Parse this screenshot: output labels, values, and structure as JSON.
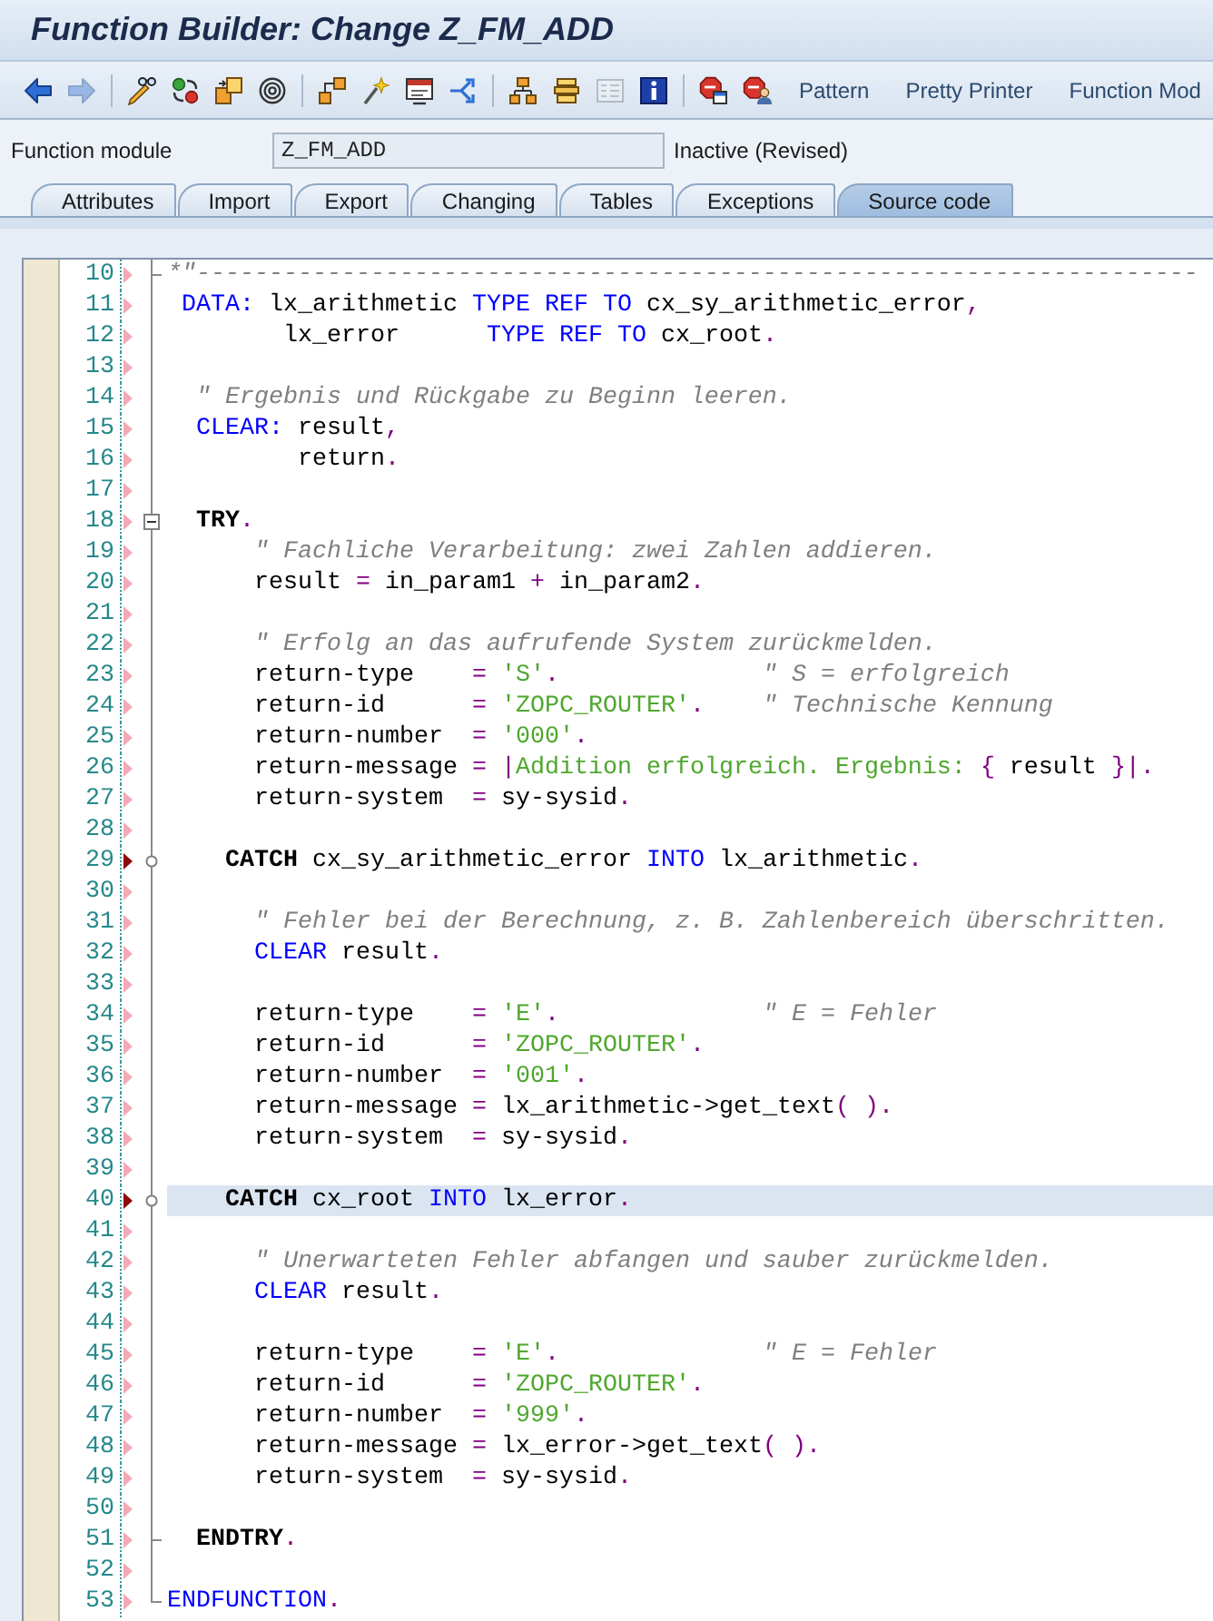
{
  "title": "Function Builder: Change Z_FM_ADD",
  "toolbar": {
    "groups": [
      [
        {
          "kind": "left",
          "disabled": false
        },
        {
          "kind": "right",
          "disabled": true
        }
      ],
      [
        {
          "kind": "pencil",
          "disabled": false
        },
        {
          "kind": "dots",
          "disabled": false
        },
        {
          "kind": "squares",
          "disabled": false
        },
        {
          "kind": "spiral",
          "disabled": false
        }
      ],
      [
        {
          "kind": "boxes",
          "disabled": false
        },
        {
          "kind": "wand",
          "disabled": false
        },
        {
          "kind": "screen",
          "disabled": false
        },
        {
          "kind": "branch",
          "disabled": false
        }
      ],
      [
        {
          "kind": "tree",
          "disabled": false
        },
        {
          "kind": "stack",
          "disabled": false
        },
        {
          "kind": "list",
          "disabled": true
        },
        {
          "kind": "info",
          "disabled": false
        }
      ],
      [
        {
          "kind": "stop",
          "disabled": false
        },
        {
          "kind": "stopuser",
          "disabled": false
        }
      ]
    ],
    "buttons": [
      "Pattern",
      "Pretty Printer",
      "Function Mod"
    ]
  },
  "module_field": {
    "label": "Function module",
    "value": "Z_FM_ADD",
    "status": "Inactive (Revised)"
  },
  "tabs": [
    {
      "label": "Attributes",
      "selected": false
    },
    {
      "label": "Import",
      "selected": false
    },
    {
      "label": "Export",
      "selected": false
    },
    {
      "label": "Changing",
      "selected": false
    },
    {
      "label": "Tables",
      "selected": false
    },
    {
      "label": "Exceptions",
      "selected": false
    },
    {
      "label": "Source code",
      "selected": true
    }
  ],
  "editor": {
    "lines": [
      {
        "number": "10",
        "kind": "tick",
        "flagged": false,
        "highlighted": false,
        "tokens": [
          {
            "text": "*\"---------------------------------------------------------------------",
            "kind": "comment"
          }
        ]
      },
      {
        "number": "11",
        "kind": "plain",
        "flagged": false,
        "highlighted": false,
        "tokens": [
          {
            "text": " DATA:",
            "kind": "keyword"
          },
          {
            "text": " lx_arithmetic ",
            "kind": "text"
          },
          {
            "text": "TYPE REF TO",
            "kind": "keyword"
          },
          {
            "text": " cx_sy_arithmetic_error",
            "kind": "text"
          },
          {
            "text": ",",
            "kind": "operator"
          }
        ]
      },
      {
        "number": "12",
        "kind": "plain",
        "flagged": false,
        "highlighted": false,
        "tokens": [
          {
            "text": "        lx_error      ",
            "kind": "text"
          },
          {
            "text": "TYPE REF TO",
            "kind": "keyword"
          },
          {
            "text": " cx_root",
            "kind": "text"
          },
          {
            "text": ".",
            "kind": "operator"
          }
        ]
      },
      {
        "number": "13",
        "kind": "plain",
        "flagged": false,
        "highlighted": false
      },
      {
        "number": "14",
        "kind": "plain",
        "flagged": false,
        "highlighted": false,
        "tokens": [
          {
            "text": "  \" Ergebnis und Rückgabe zu Beginn leeren.",
            "kind": "comment"
          }
        ]
      },
      {
        "number": "15",
        "kind": "plain",
        "flagged": false,
        "highlighted": false,
        "tokens": [
          {
            "text": "  CLEAR:",
            "kind": "keyword"
          },
          {
            "text": " result",
            "kind": "text"
          },
          {
            "text": ",",
            "kind": "operator"
          }
        ]
      },
      {
        "number": "16",
        "kind": "plain",
        "flagged": false,
        "highlighted": false,
        "tokens": [
          {
            "text": "         return",
            "kind": "text"
          },
          {
            "text": ".",
            "kind": "operator"
          }
        ]
      },
      {
        "number": "17",
        "kind": "plain",
        "flagged": false,
        "highlighted": false
      },
      {
        "number": "18",
        "kind": "start",
        "flagged": false,
        "highlighted": false,
        "tokens": [
          {
            "text": "  TRY",
            "kind": "control"
          },
          {
            "text": ".",
            "kind": "operator"
          }
        ]
      },
      {
        "number": "19",
        "kind": "plain",
        "flagged": false,
        "highlighted": false,
        "tokens": [
          {
            "text": "      \" Fachliche Verarbeitung: zwei Zahlen addieren.",
            "kind": "comment"
          }
        ]
      },
      {
        "number": "20",
        "kind": "plain",
        "flagged": false,
        "highlighted": false,
        "tokens": [
          {
            "text": "      result ",
            "kind": "text"
          },
          {
            "text": "=",
            "kind": "operator"
          },
          {
            "text": " in_param1 ",
            "kind": "text"
          },
          {
            "text": "+",
            "kind": "operator"
          },
          {
            "text": " in_param2",
            "kind": "text"
          },
          {
            "text": ".",
            "kind": "operator"
          }
        ]
      },
      {
        "number": "21",
        "kind": "plain",
        "flagged": false,
        "highlighted": false
      },
      {
        "number": "22",
        "kind": "plain",
        "flagged": false,
        "highlighted": false,
        "tokens": [
          {
            "text": "      \" Erfolg an das aufrufende System zurückmelden.",
            "kind": "comment"
          }
        ]
      },
      {
        "number": "23",
        "kind": "plain",
        "flagged": false,
        "highlighted": false,
        "tokens": [
          {
            "text": "      return-type    ",
            "kind": "text"
          },
          {
            "text": "= ",
            "kind": "operator"
          },
          {
            "text": "'S'",
            "kind": "string"
          },
          {
            "text": ".",
            "kind": "operator"
          },
          {
            "text": "              \" S = erfolgreich",
            "kind": "comment"
          }
        ]
      },
      {
        "number": "24",
        "kind": "plain",
        "flagged": false,
        "highlighted": false,
        "tokens": [
          {
            "text": "      return-id      ",
            "kind": "text"
          },
          {
            "text": "= ",
            "kind": "operator"
          },
          {
            "text": "'ZOPC_ROUTER'",
            "kind": "string"
          },
          {
            "text": ".",
            "kind": "operator"
          },
          {
            "text": "    \" Technische Kennung",
            "kind": "comment"
          }
        ]
      },
      {
        "number": "25",
        "kind": "plain",
        "flagged": false,
        "highlighted": false,
        "tokens": [
          {
            "text": "      return-number  ",
            "kind": "text"
          },
          {
            "text": "= ",
            "kind": "operator"
          },
          {
            "text": "'000'",
            "kind": "string"
          },
          {
            "text": ".",
            "kind": "operator"
          }
        ]
      },
      {
        "number": "26",
        "kind": "plain",
        "flagged": false,
        "highlighted": false,
        "tokens": [
          {
            "text": "      return-message ",
            "kind": "text"
          },
          {
            "text": "= |",
            "kind": "operator"
          },
          {
            "text": "Addition erfolgreich. Ergebnis: ",
            "kind": "string"
          },
          {
            "text": "{",
            "kind": "operator"
          },
          {
            "text": " result ",
            "kind": "text"
          },
          {
            "text": "}|.",
            "kind": "operator"
          }
        ]
      },
      {
        "number": "27",
        "kind": "plain",
        "flagged": false,
        "highlighted": false,
        "tokens": [
          {
            "text": "      return-system  ",
            "kind": "text"
          },
          {
            "text": "=",
            "kind": "operator"
          },
          {
            "text": " sy-sysid",
            "kind": "text"
          },
          {
            "text": ".",
            "kind": "operator"
          }
        ]
      },
      {
        "number": "28",
        "kind": "plain",
        "flagged": false,
        "highlighted": false
      },
      {
        "number": "29",
        "kind": "branch",
        "flagged": true,
        "highlighted": false,
        "tokens": [
          {
            "text": "    CATCH",
            "kind": "control"
          },
          {
            "text": " cx_sy_arithmetic_error ",
            "kind": "text"
          },
          {
            "text": "INTO",
            "kind": "keyword"
          },
          {
            "text": " lx_arithmetic",
            "kind": "text"
          },
          {
            "text": ".",
            "kind": "operator"
          }
        ]
      },
      {
        "number": "30",
        "kind": "plain",
        "flagged": false,
        "highlighted": false
      },
      {
        "number": "31",
        "kind": "plain",
        "flagged": false,
        "highlighted": false,
        "tokens": [
          {
            "text": "      \" Fehler bei der Berechnung, z. B. Zahlenbereich überschritten.",
            "kind": "comment"
          }
        ]
      },
      {
        "number": "32",
        "kind": "plain",
        "flagged": false,
        "highlighted": false,
        "tokens": [
          {
            "text": "      CLEAR",
            "kind": "keyword"
          },
          {
            "text": " result",
            "kind": "text"
          },
          {
            "text": ".",
            "kind": "operator"
          }
        ]
      },
      {
        "number": "33",
        "kind": "plain",
        "flagged": false,
        "highlighted": false
      },
      {
        "number": "34",
        "kind": "plain",
        "flagged": false,
        "highlighted": false,
        "tokens": [
          {
            "text": "      return-type    ",
            "kind": "text"
          },
          {
            "text": "= ",
            "kind": "operator"
          },
          {
            "text": "'E'",
            "kind": "string"
          },
          {
            "text": ".",
            "kind": "operator"
          },
          {
            "text": "              \" E = Fehler",
            "kind": "comment"
          }
        ]
      },
      {
        "number": "35",
        "kind": "plain",
        "flagged": false,
        "highlighted": false,
        "tokens": [
          {
            "text": "      return-id      ",
            "kind": "text"
          },
          {
            "text": "= ",
            "kind": "operator"
          },
          {
            "text": "'ZOPC_ROUTER'",
            "kind": "string"
          },
          {
            "text": ".",
            "kind": "operator"
          }
        ]
      },
      {
        "number": "36",
        "kind": "plain",
        "flagged": false,
        "highlighted": false,
        "tokens": [
          {
            "text": "      return-number  ",
            "kind": "text"
          },
          {
            "text": "= ",
            "kind": "operator"
          },
          {
            "text": "'001'",
            "kind": "string"
          },
          {
            "text": ".",
            "kind": "operator"
          }
        ]
      },
      {
        "number": "37",
        "kind": "plain",
        "flagged": false,
        "highlighted": false,
        "tokens": [
          {
            "text": "      return-message ",
            "kind": "text"
          },
          {
            "text": "=",
            "kind": "operator"
          },
          {
            "text": " lx_arithmetic->get_text",
            "kind": "text"
          },
          {
            "text": "( ).",
            "kind": "operator"
          }
        ]
      },
      {
        "number": "38",
        "kind": "plain",
        "flagged": false,
        "highlighted": false,
        "tokens": [
          {
            "text": "      return-system  ",
            "kind": "text"
          },
          {
            "text": "=",
            "kind": "operator"
          },
          {
            "text": " sy-sysid",
            "kind": "text"
          },
          {
            "text": ".",
            "kind": "operator"
          }
        ]
      },
      {
        "number": "39",
        "kind": "plain",
        "flagged": false,
        "highlighted": false
      },
      {
        "number": "40",
        "kind": "branch",
        "flagged": true,
        "highlighted": true,
        "tokens": [
          {
            "text": "    CATCH",
            "kind": "control"
          },
          {
            "text": " cx_root ",
            "kind": "text"
          },
          {
            "text": "INTO",
            "kind": "keyword"
          },
          {
            "text": " lx_error",
            "kind": "text"
          },
          {
            "text": ".",
            "kind": "operator"
          }
        ]
      },
      {
        "number": "41",
        "kind": "plain",
        "flagged": false,
        "highlighted": false
      },
      {
        "number": "42",
        "kind": "plain",
        "flagged": false,
        "highlighted": false,
        "tokens": [
          {
            "text": "      \" Unerwarteten Fehler abfangen und sauber zurückmelden.",
            "kind": "comment"
          }
        ]
      },
      {
        "number": "43",
        "kind": "plain",
        "flagged": false,
        "highlighted": false,
        "tokens": [
          {
            "text": "      CLEAR",
            "kind": "keyword"
          },
          {
            "text": " result",
            "kind": "text"
          },
          {
            "text": ".",
            "kind": "operator"
          }
        ]
      },
      {
        "number": "44",
        "kind": "plain",
        "flagged": false,
        "highlighted": false
      },
      {
        "number": "45",
        "kind": "plain",
        "flagged": false,
        "highlighted": false,
        "tokens": [
          {
            "text": "      return-type    ",
            "kind": "text"
          },
          {
            "text": "= ",
            "kind": "operator"
          },
          {
            "text": "'E'",
            "kind": "string"
          },
          {
            "text": ".",
            "kind": "operator"
          },
          {
            "text": "              \" E = Fehler",
            "kind": "comment"
          }
        ]
      },
      {
        "number": "46",
        "kind": "plain",
        "flagged": false,
        "highlighted": false,
        "tokens": [
          {
            "text": "      return-id      ",
            "kind": "text"
          },
          {
            "text": "= ",
            "kind": "operator"
          },
          {
            "text": "'ZOPC_ROUTER'",
            "kind": "string"
          },
          {
            "text": ".",
            "kind": "operator"
          }
        ]
      },
      {
        "number": "47",
        "kind": "plain",
        "flagged": false,
        "highlighted": false,
        "tokens": [
          {
            "text": "      return-number  ",
            "kind": "text"
          },
          {
            "text": "= ",
            "kind": "operator"
          },
          {
            "text": "'999'",
            "kind": "string"
          },
          {
            "text": ".",
            "kind": "operator"
          }
        ]
      },
      {
        "number": "48",
        "kind": "plain",
        "flagged": false,
        "highlighted": false,
        "tokens": [
          {
            "text": "      return-message ",
            "kind": "text"
          },
          {
            "text": "=",
            "kind": "operator"
          },
          {
            "text": " lx_error->get_text",
            "kind": "text"
          },
          {
            "text": "( ).",
            "kind": "operator"
          }
        ]
      },
      {
        "number": "49",
        "kind": "plain",
        "flagged": false,
        "highlighted": false,
        "tokens": [
          {
            "text": "      return-system  ",
            "kind": "text"
          },
          {
            "text": "=",
            "kind": "operator"
          },
          {
            "text": " sy-sysid",
            "kind": "text"
          },
          {
            "text": ".",
            "kind": "operator"
          }
        ]
      },
      {
        "number": "50",
        "kind": "plain",
        "flagged": false,
        "highlighted": false
      },
      {
        "number": "51",
        "kind": "tick",
        "flagged": false,
        "highlighted": false,
        "tokens": [
          {
            "text": "  ENDTRY",
            "kind": "control"
          },
          {
            "text": ".",
            "kind": "operator"
          }
        ]
      },
      {
        "number": "52",
        "kind": "plain",
        "flagged": false,
        "highlighted": false
      },
      {
        "number": "53",
        "kind": "end",
        "flagged": false,
        "highlighted": false,
        "tokens": [
          {
            "text": "ENDFUNCTION",
            "kind": "keyword"
          },
          {
            "text": ".",
            "kind": "operator"
          }
        ]
      }
    ]
  }
}
